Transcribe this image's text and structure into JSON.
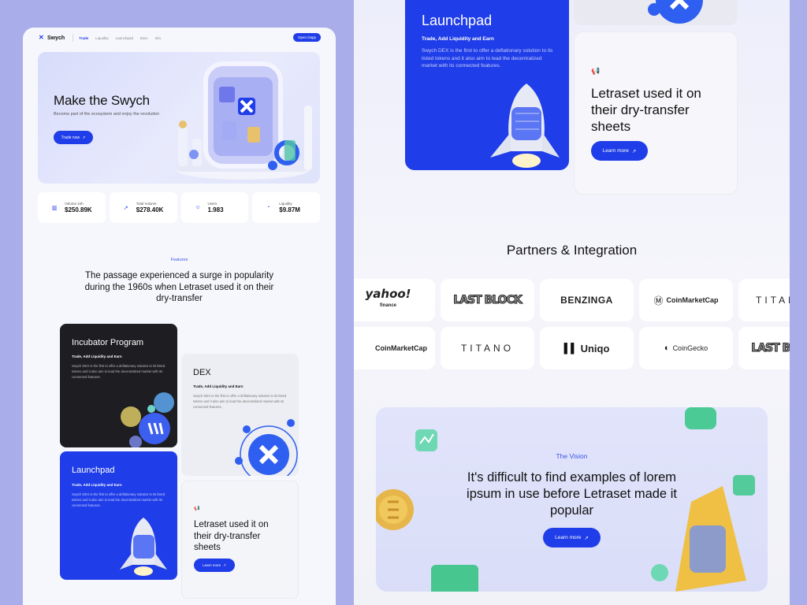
{
  "nav": {
    "brand": "Swych",
    "links": [
      "Trade",
      "Liquidity",
      "Launchpad",
      "Earn",
      "Info"
    ],
    "open_app": "Open Dapp"
  },
  "hero": {
    "title": "Make the Swych",
    "subtitle": "Become part of the ecosystem and enjoy the revolution",
    "cta": "Trade now"
  },
  "stats": [
    {
      "label": "Volume 24h",
      "value": "$250.89K",
      "icon": "bar-chart-icon"
    },
    {
      "label": "Total Volume",
      "value": "$278.40K",
      "icon": "arrow-up-right-icon"
    },
    {
      "label": "Users",
      "value": "1.983",
      "icon": "users-icon"
    },
    {
      "label": "Liquidity",
      "value": "$9.87M",
      "icon": "pie-chart-icon"
    }
  ],
  "features": {
    "tag": "Features",
    "title": "The passage experienced a surge in popularity during the 1960s when Letraset used it on their dry-transfer"
  },
  "cards": {
    "incubator": {
      "title": "Incubator Program",
      "sub": "Trade, Add Liquidity and Earn",
      "desc": "Swych DEX is the first to offer a deflationary solution to its listed tokens and it also aim to lead the decentralized market with its connected features."
    },
    "dex": {
      "title": "DEX",
      "sub": "Trade, Add Liquidity and Earn",
      "desc": "Swych DEX is the first to offer a deflationary solution to its listed tokens and it also aim to lead the decentralized market with its connected features."
    },
    "launchpad": {
      "title": "Launchpad",
      "sub": "Trade, Add Liquidity and Earn",
      "desc": "Swych DEX is the first to offer a deflationary solution to its listed tokens and it also aim to lead the decentralized market with its connected features."
    },
    "letraset": {
      "title": "Letraset used it on their dry-transfer sheets",
      "cta": "Learn more"
    }
  },
  "partners": {
    "title": "Partners & Integration",
    "row1": [
      "yahoo!",
      "LAST BLOCK",
      "BENZINGA",
      "CoinMarketCap",
      "TITANO"
    ],
    "row2": [
      "CoinMarketCap",
      "TITANO",
      "Uniqo",
      "CoinGecko",
      "LAST BLOCK"
    ],
    "yahoo_sub": "finance"
  },
  "vision": {
    "tag": "The Vision",
    "title": "It's difficult to find examples of lorem ipsum in use before Letraset made it popular",
    "cta": "Learn more"
  },
  "colors": {
    "accent": "#1f3de8",
    "page_bg": "#a9aeea",
    "dark_card": "#1e1e22"
  }
}
